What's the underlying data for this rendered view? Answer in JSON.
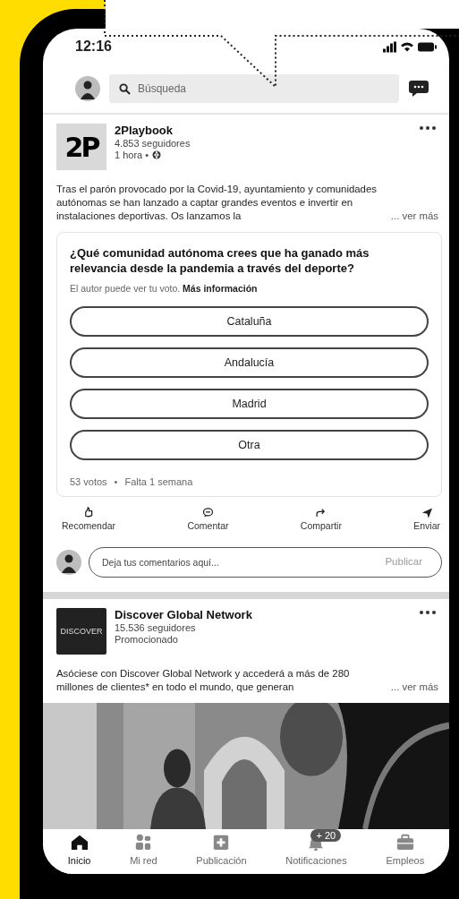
{
  "status_bar": {
    "time": "12:16"
  },
  "header": {
    "search": {
      "placeholder": "Búsqueda"
    }
  },
  "posts": [
    {
      "kind": "poll",
      "author": "2Playbook",
      "logo_text": "2P",
      "followers": "4.853 seguidores",
      "meta": "1 hora •",
      "text": "Tras el parón provocado por la Covid-19, ayuntamiento y comunidades autónomas se han lanzado a captar grandes eventos e invertir en instalaciones deportivas. Os lanzamos la",
      "more": "... ver más",
      "poll": {
        "question": "¿Qué comunidad autónoma crees que ha ganado más relevancia desde la pandemia a través del deporte?",
        "note": "El autor puede ver tu voto. **Más información**",
        "options": [
          {
            "label": "Cataluña",
            "selected": false
          },
          {
            "label": "Andalucía",
            "selected": false
          },
          {
            "label": "Madrid",
            "selected": false
          },
          {
            "label": "Otra",
            "selected": false
          }
        ],
        "votes": "53 votos",
        "separator": "•",
        "remaining": "Falta 1 semana"
      },
      "actions": [
        "Recomendar",
        "Comentar",
        "Compartir",
        "Enviar"
      ],
      "comment": {
        "placeholder": "Deja tus comentarios aquí...",
        "submit": "Publicar"
      }
    },
    {
      "kind": "ad",
      "author": "Discover Global Network",
      "logo_text": "DISCOVER",
      "followers": "15.536 seguidores",
      "meta": "Promocionado",
      "text": "Asóciese con Discover Global Network y accederá a más de 280 millones de clientes* en todo el mundo, que generan",
      "more": "... ver más"
    }
  ],
  "bottom_nav": [
    {
      "label": "Inicio",
      "selected": true
    },
    {
      "label": "Mi red",
      "selected": false
    },
    {
      "label": "Publicación",
      "selected": false
    },
    {
      "label": "Notificaciones",
      "selected": false,
      "badge": "+ 20"
    },
    {
      "label": "Empleos",
      "selected": false
    }
  ]
}
